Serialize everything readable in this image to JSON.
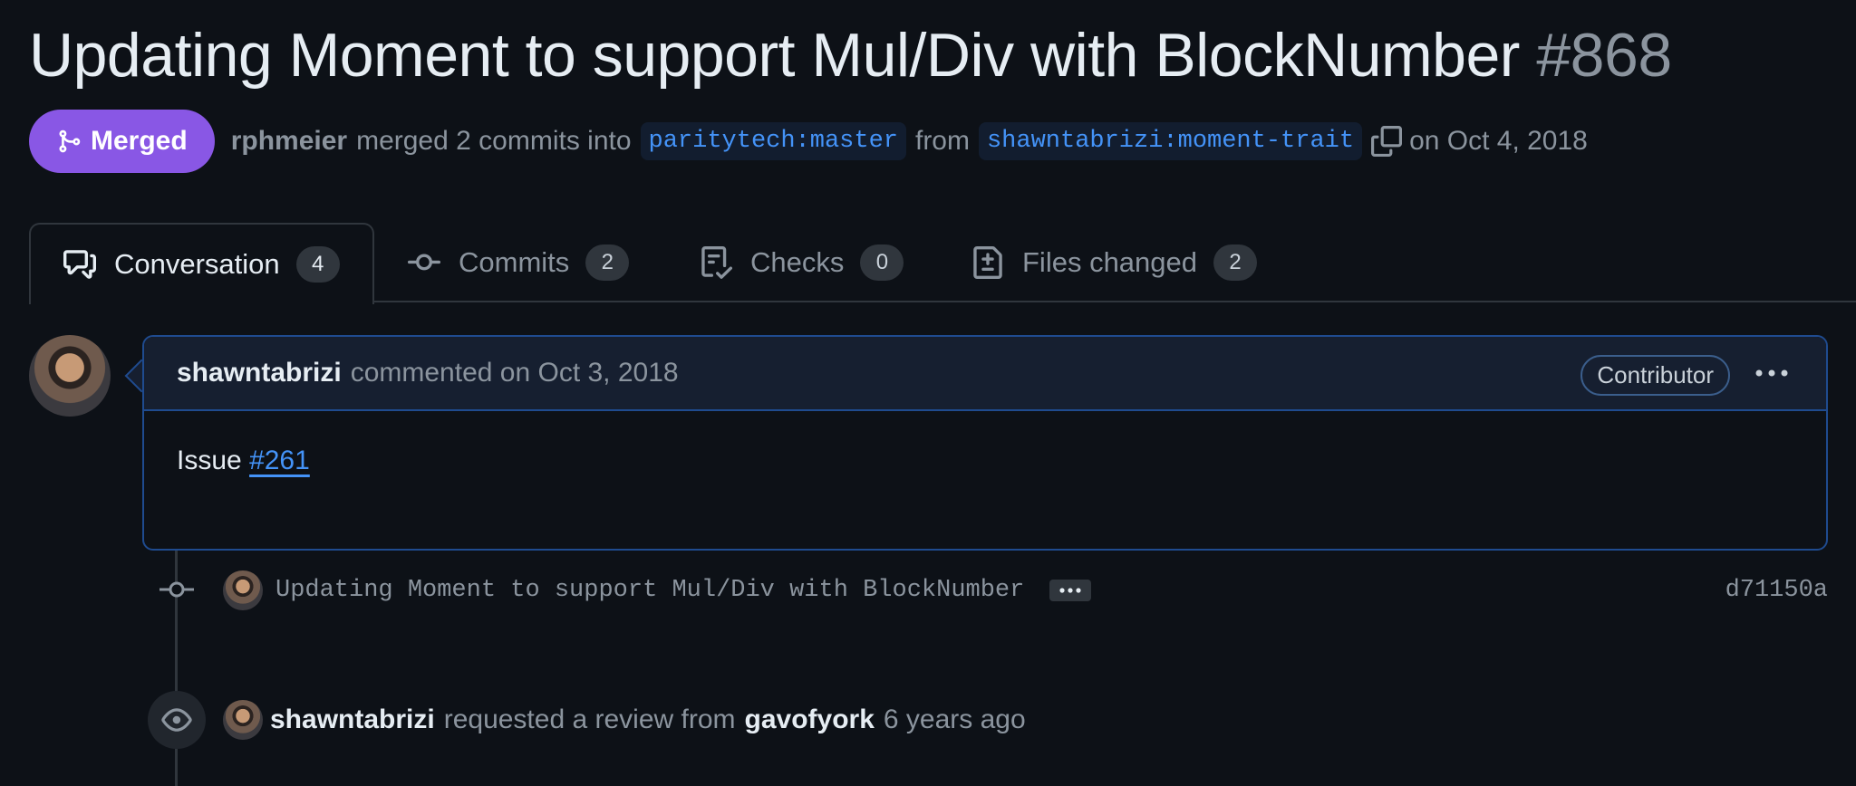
{
  "pr": {
    "title": "Updating Moment to support Mul/Div with BlockNumber",
    "number": "#868",
    "status": "Merged",
    "merged_by": "rphmeier",
    "merged_text": "merged 2 commits into",
    "base_branch": "paritytech:master",
    "from_text": "from",
    "head_branch": "shawntabrizi:moment-trait",
    "merged_date": "on Oct 4, 2018"
  },
  "tabs": [
    {
      "label": "Conversation",
      "count": "4",
      "icon": "comment-discussion-icon"
    },
    {
      "label": "Commits",
      "count": "2",
      "icon": "git-commit-icon"
    },
    {
      "label": "Checks",
      "count": "0",
      "icon": "checklist-icon"
    },
    {
      "label": "Files changed",
      "count": "2",
      "icon": "file-diff-icon"
    }
  ],
  "comment": {
    "author": "shawntabrizi",
    "meta": "commented on Oct 3, 2018",
    "role": "Contributor",
    "body_prefix": "Issue",
    "issue_link": "#261"
  },
  "timeline": {
    "commit": {
      "message": "Updating Moment to support Mul/Div with BlockNumber",
      "sha": "d71150a"
    },
    "review_request": {
      "author": "shawntabrizi",
      "text": "requested a review from",
      "reviewer": "gavofyork",
      "time": "6 years ago"
    }
  },
  "colors": {
    "background": "#0d1117",
    "merged": "#8957e5",
    "link": "#4493f8",
    "comment_border": "#1f4b8f"
  }
}
